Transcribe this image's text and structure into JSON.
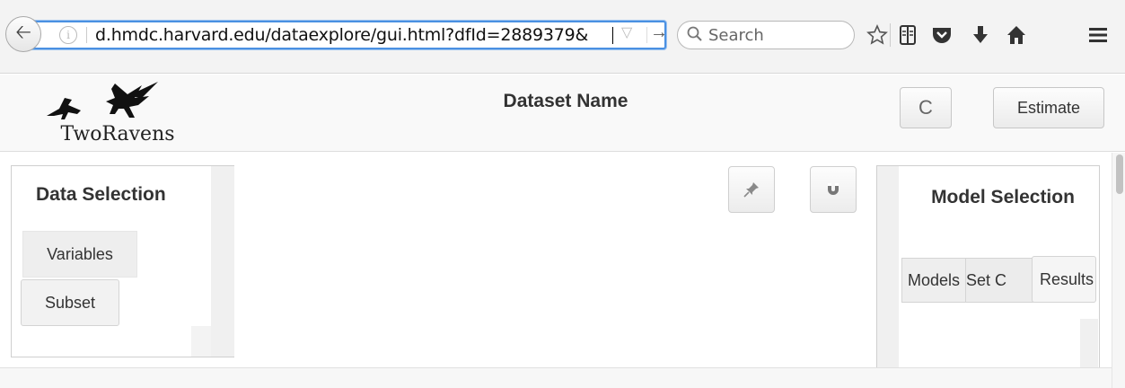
{
  "browser": {
    "url": "d.hmdc.harvard.edu/dataexplore/gui.html?dfId=2889379&",
    "search_placeholder": "Search",
    "icons": [
      "back-arrow-icon",
      "info-icon",
      "url-dropdown-icon",
      "go-arrow-icon",
      "search-icon",
      "bookmark-star-icon",
      "reading-list-icon",
      "pocket-icon",
      "download-icon",
      "home-icon",
      "menu-icon"
    ]
  },
  "header": {
    "logo_text": "TwoRavens",
    "title": "Dataset Name",
    "reset_icon": "C",
    "estimate_label": "Estimate"
  },
  "left_panel": {
    "title": "Data Selection",
    "tabs": [
      "Variables",
      "Subset"
    ]
  },
  "canvas_controls": {
    "icons": [
      "pin-icon",
      "magnet-icon"
    ]
  },
  "right_panel": {
    "title": "Model Selection",
    "tabs": [
      "Models",
      "Set C",
      "Results"
    ]
  },
  "colors": {
    "url_focus": "#4a90e2",
    "header_bg": "#f9f9f9",
    "toolbar_bg": "#f3f3f3"
  }
}
